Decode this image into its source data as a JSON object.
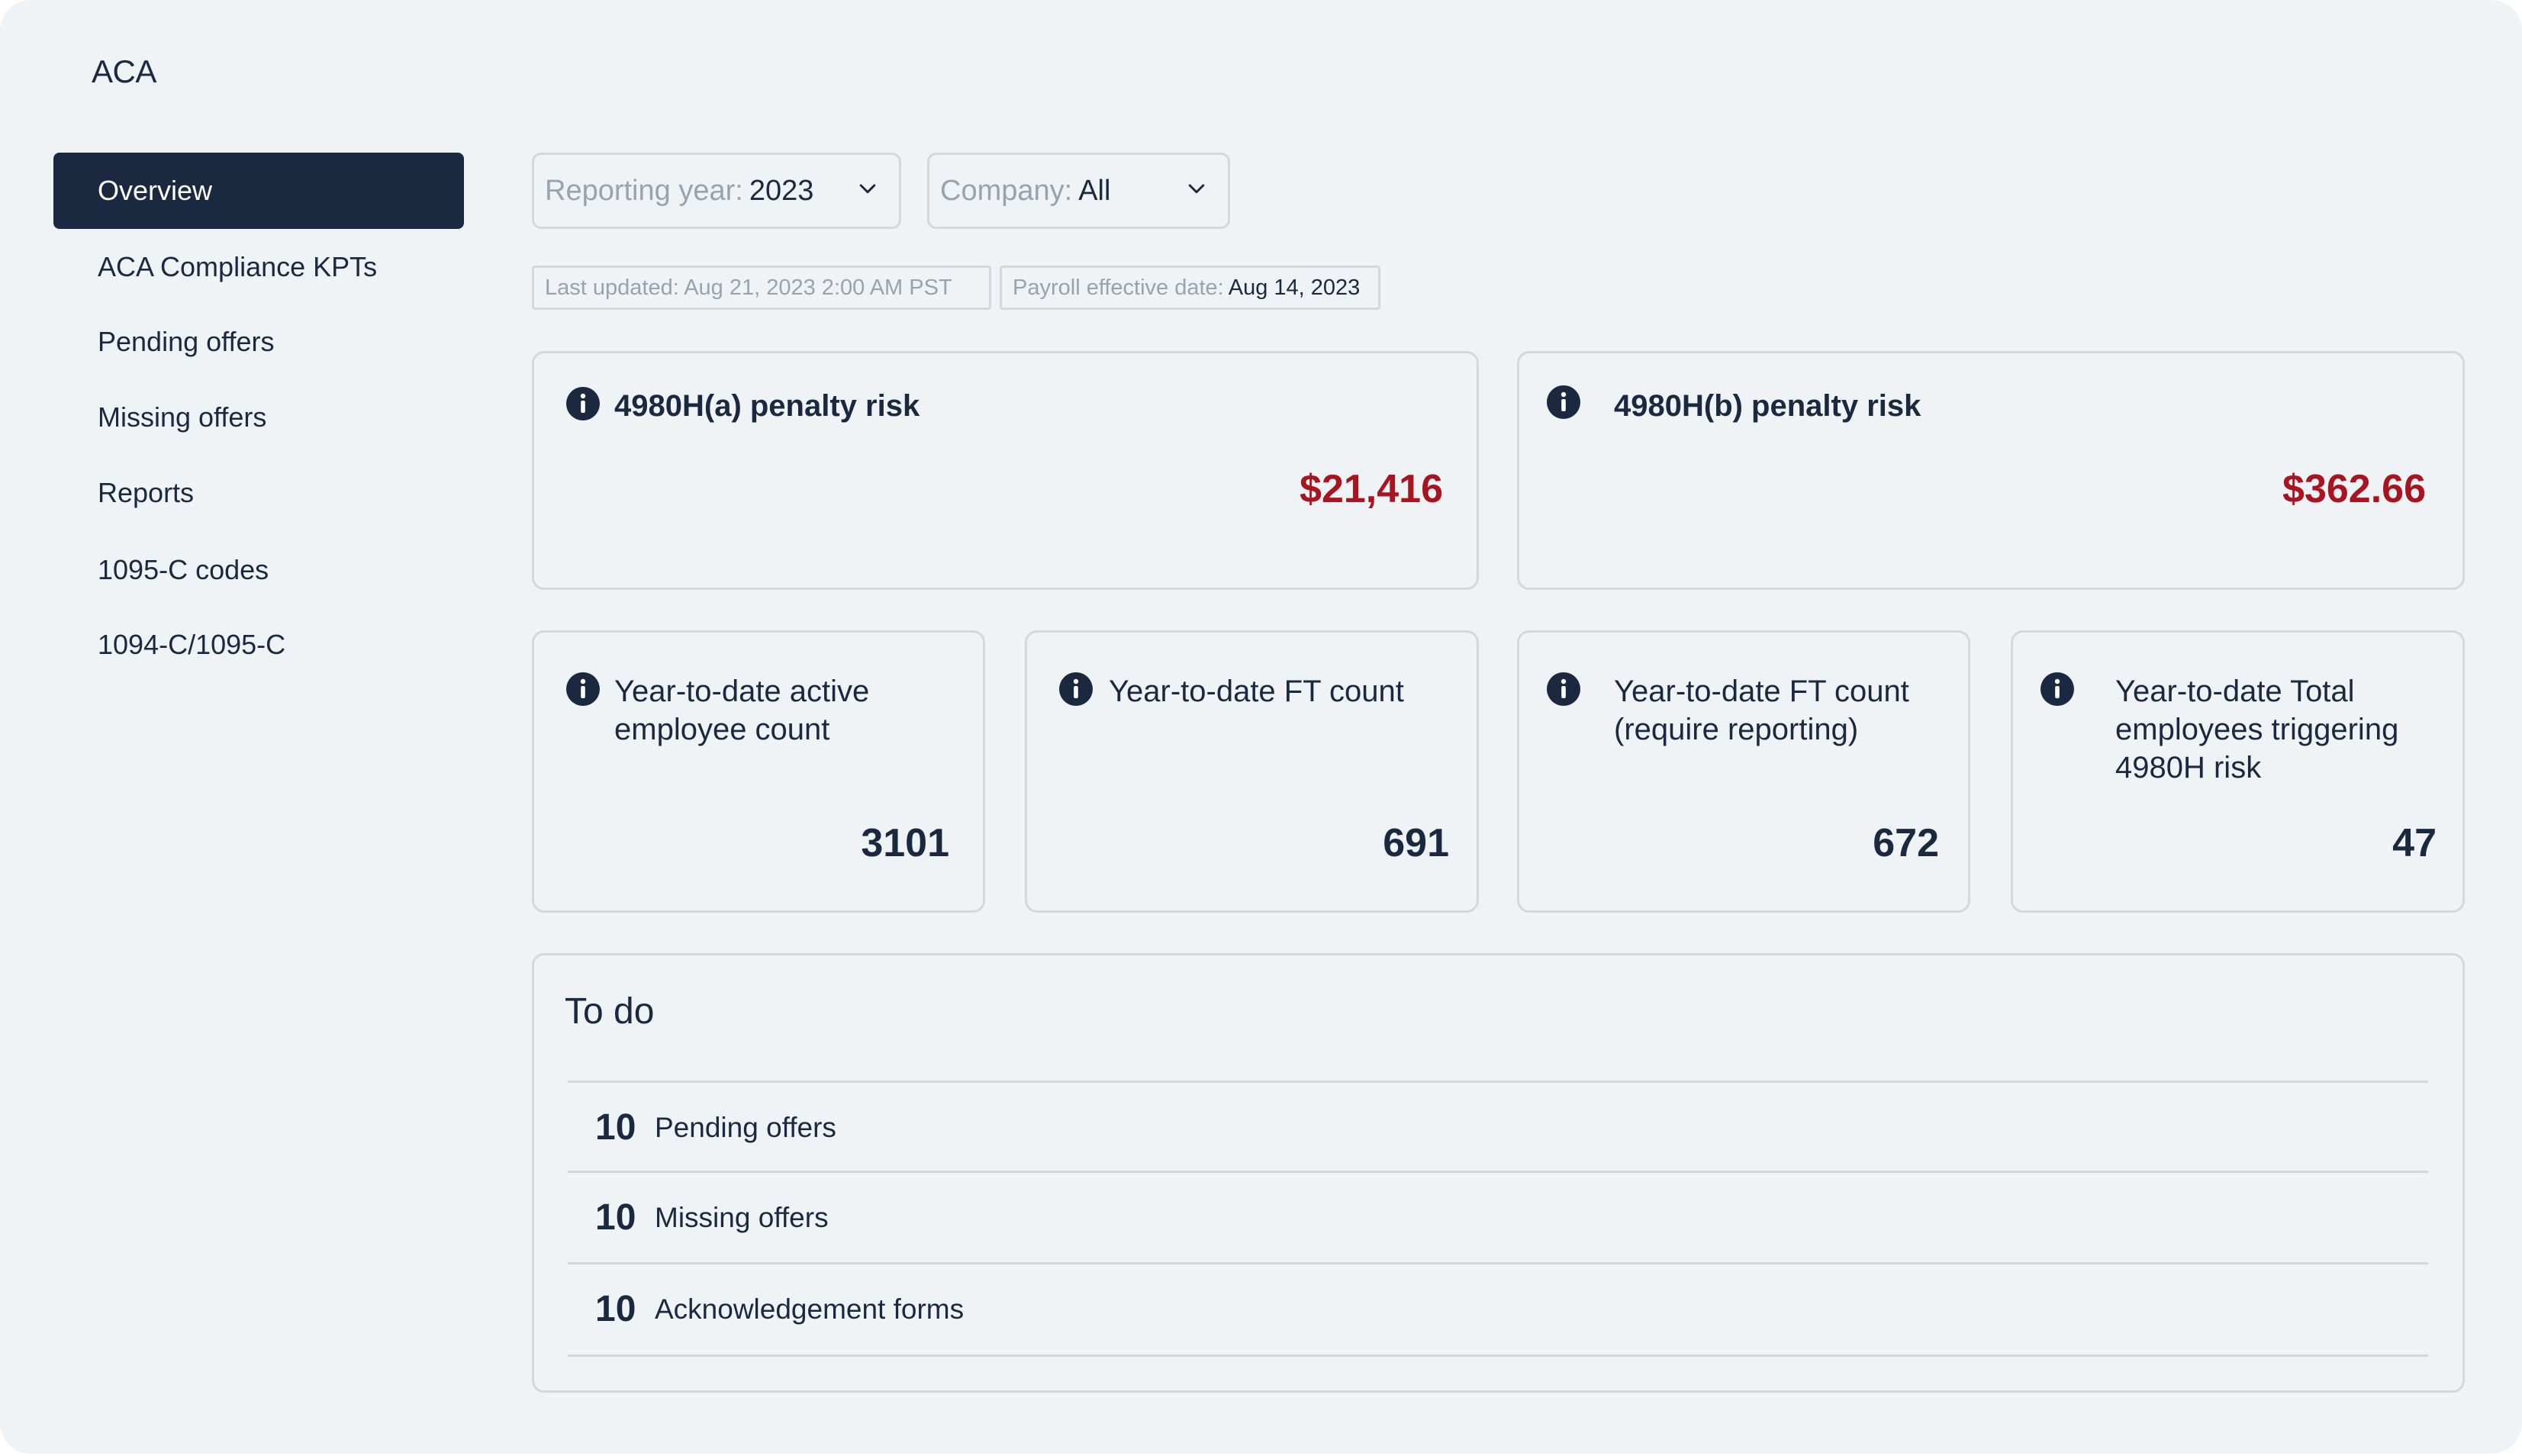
{
  "app": {
    "title": "ACA"
  },
  "sidebar": {
    "items": [
      {
        "label": "Overview",
        "active": true
      },
      {
        "label": "ACA Compliance KPTs"
      },
      {
        "label": "Pending offers"
      },
      {
        "label": "Missing offers"
      },
      {
        "label": "Reports"
      },
      {
        "label": "1095-C codes"
      },
      {
        "label": "1094-C/1095-C"
      }
    ]
  },
  "filters": {
    "year": {
      "label": "Reporting year:",
      "value": "2023",
      "icon": "chevron-down-icon"
    },
    "company": {
      "label": "Company:",
      "value": "All",
      "icon": "chevron-down-icon"
    }
  },
  "meta": {
    "last_updated": "Last updated: Aug 21, 2023  2:00 AM PST",
    "payroll_label": "Payroll effective date:",
    "payroll_date": "Aug 14, 2023"
  },
  "penalties": [
    {
      "title": "4980H(a) penalty risk",
      "value": "$21,416",
      "icon": "info-icon"
    },
    {
      "title": "4980H(b) penalty risk",
      "value": "$362.66",
      "icon": "info-icon"
    }
  ],
  "kpis": [
    {
      "title_line1": "Year-to-date active",
      "title_line2": "employee count",
      "title_line3": "",
      "value": "3101"
    },
    {
      "title_line1": "Year-to-date FT count",
      "title_line2": "",
      "title_line3": "",
      "value": "691"
    },
    {
      "title_line1": "Year-to-date FT count",
      "title_line2": "(require reporting)",
      "title_line3": "",
      "value": "672"
    },
    {
      "title_line1": "Year-to-date Total",
      "title_line2": "employees triggering",
      "title_line3": "4980H risk",
      "value": "47"
    }
  ],
  "todo": {
    "title": "To do",
    "items": [
      {
        "count": "10",
        "label": "Pending offers"
      },
      {
        "count": "10",
        "label": "Missing offers"
      },
      {
        "count": "10",
        "label": "Acknowledgement forms"
      }
    ]
  },
  "colors": {
    "background": "#eff3f5",
    "navy": "#1b2940",
    "risk_red": "#a8141f",
    "border": "#d3d8de",
    "muted_text": "#99a3b0"
  }
}
